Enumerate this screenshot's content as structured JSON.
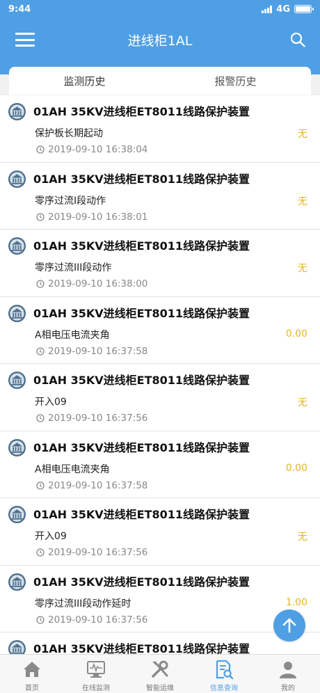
{
  "status": {
    "time": "9:44",
    "network": "4G"
  },
  "header": {
    "title": "进线柜1AL"
  },
  "tabs": [
    {
      "label": "监测历史",
      "active": true
    },
    {
      "label": "报警历史",
      "active": false
    }
  ],
  "records": [
    {
      "title": "01AH 35KV进线柜ET8011线路保护装置",
      "desc": "保护板长期起动",
      "value": "无",
      "time": "2019-09-10 16:38:04"
    },
    {
      "title": "01AH 35KV进线柜ET8011线路保护装置",
      "desc": "零序过流I段动作",
      "value": "无",
      "time": "2019-09-10 16:38:01"
    },
    {
      "title": "01AH 35KV进线柜ET8011线路保护装置",
      "desc": "零序过流III段动作",
      "value": "无",
      "time": "2019-09-10 16:38:00"
    },
    {
      "title": "01AH 35KV进线柜ET8011线路保护装置",
      "desc": "A相电压电流夹角",
      "value": "0.00",
      "time": "2019-09-10 16:37:58"
    },
    {
      "title": "01AH 35KV进线柜ET8011线路保护装置",
      "desc": "开入09",
      "value": "无",
      "time": "2019-09-10 16:37:56"
    },
    {
      "title": "01AH 35KV进线柜ET8011线路保护装置",
      "desc": "A相电压电流夹角",
      "value": "0.00",
      "time": "2019-09-10 16:37:58"
    },
    {
      "title": "01AH 35KV进线柜ET8011线路保护装置",
      "desc": "开入09",
      "value": "无",
      "time": "2019-09-10 16:37:56"
    },
    {
      "title": "01AH 35KV进线柜ET8011线路保护装置",
      "desc": "零序过流III段动作延时",
      "value": "1.00",
      "time": "2019-09-10 16:37:56"
    },
    {
      "title": "01AH 35KV进线柜ET8011线路保护装置",
      "desc": "",
      "value": "",
      "time": ""
    }
  ],
  "bottom_nav": [
    {
      "label": "首页",
      "icon": "home-icon",
      "active": false
    },
    {
      "label": "在线监测",
      "icon": "monitor-icon",
      "active": false
    },
    {
      "label": "智能运维",
      "icon": "tools-icon",
      "active": false
    },
    {
      "label": "信息查询",
      "icon": "document-search-icon",
      "active": true
    },
    {
      "label": "我的",
      "icon": "user-icon",
      "active": false
    }
  ],
  "colors": {
    "primary": "#4f9fe4",
    "value": "#e8b320",
    "accent_active": "#4f9fe4"
  }
}
